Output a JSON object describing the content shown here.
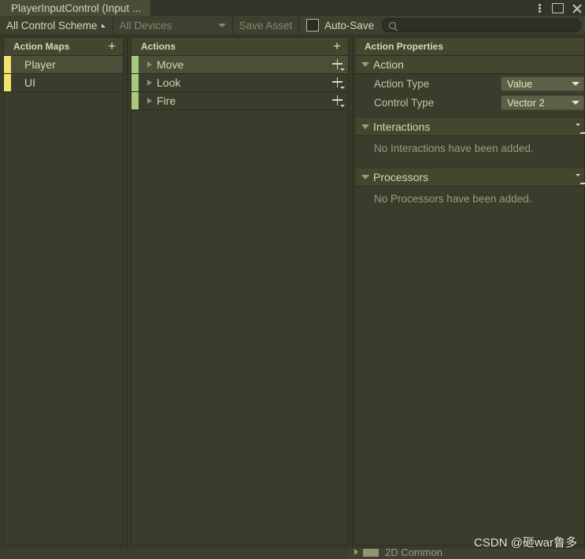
{
  "window": {
    "tab_title": "PlayerInputControl (Input ...",
    "controls": [
      {
        "name": "more-menu",
        "icon": "vertical-dots-icon"
      },
      {
        "name": "maximize",
        "icon": "square-icon"
      },
      {
        "name": "close",
        "icon": "close-icon"
      }
    ]
  },
  "toolbar": {
    "control_scheme": "All Control Scheme",
    "devices": "All Devices",
    "save_asset": "Save Asset",
    "auto_save_label": "Auto-Save",
    "auto_save_checked": false,
    "search_placeholder": "",
    "search_value": "",
    "search_icon": "search-icon"
  },
  "action_maps": {
    "title": "Action Maps",
    "add_label": "+",
    "marker_color": "#f2e26e",
    "items": [
      {
        "label": "Player",
        "selected": true
      },
      {
        "label": "UI",
        "selected": false
      }
    ]
  },
  "actions": {
    "title": "Actions",
    "add_label": "+",
    "marker_color": "#a9c97f",
    "items": [
      {
        "label": "Move",
        "selected": true,
        "expanded": false
      },
      {
        "label": "Look",
        "selected": false,
        "expanded": false
      },
      {
        "label": "Fire",
        "selected": false,
        "expanded": false
      }
    ]
  },
  "properties": {
    "title": "Action Properties",
    "action_section": {
      "label": "Action",
      "expanded": true,
      "fields": [
        {
          "label": "Action Type",
          "value": "Value"
        },
        {
          "label": "Control Type",
          "value": "Vector 2"
        }
      ]
    },
    "interactions_section": {
      "label": "Interactions",
      "expanded": true,
      "empty_message": "No Interactions have been added."
    },
    "processors_section": {
      "label": "Processors",
      "expanded": true,
      "empty_message": "No Processors have been added."
    }
  },
  "background": {
    "row_label": "2D  Common"
  },
  "watermark": "CSDN @砸war鲁多"
}
